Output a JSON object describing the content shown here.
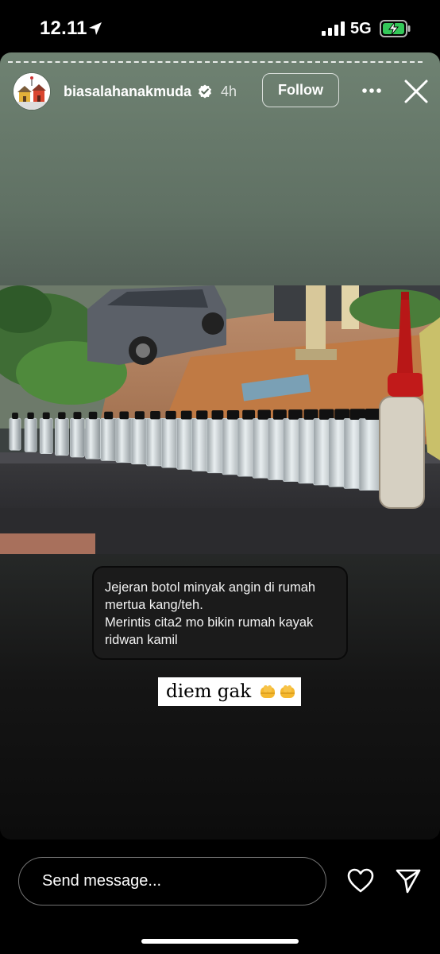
{
  "status_bar": {
    "time": "12.11",
    "network": "5G",
    "icons": [
      "location-arrow-icon",
      "signal-bars-icon",
      "battery-charging-icon"
    ]
  },
  "story": {
    "username": "biasalahanakmuda",
    "age": "4h",
    "follow_label": "Follow",
    "verified": true,
    "caption_lines": [
      "Jejeran botol minyak angin di rumah",
      "mertua kang/teh.",
      "Merintis cita2 mo bikin rumah kayak",
      "ridwan kamil"
    ],
    "sticker_text": "diem gak",
    "sticker_emoji": "oncoming-fist x2"
  },
  "reply_bar": {
    "placeholder": "Send message..."
  },
  "colors": {
    "background": "#000000",
    "story_top": "#6f8272",
    "verified_badge": "#ffffff",
    "battery_fill": "#34c759"
  }
}
